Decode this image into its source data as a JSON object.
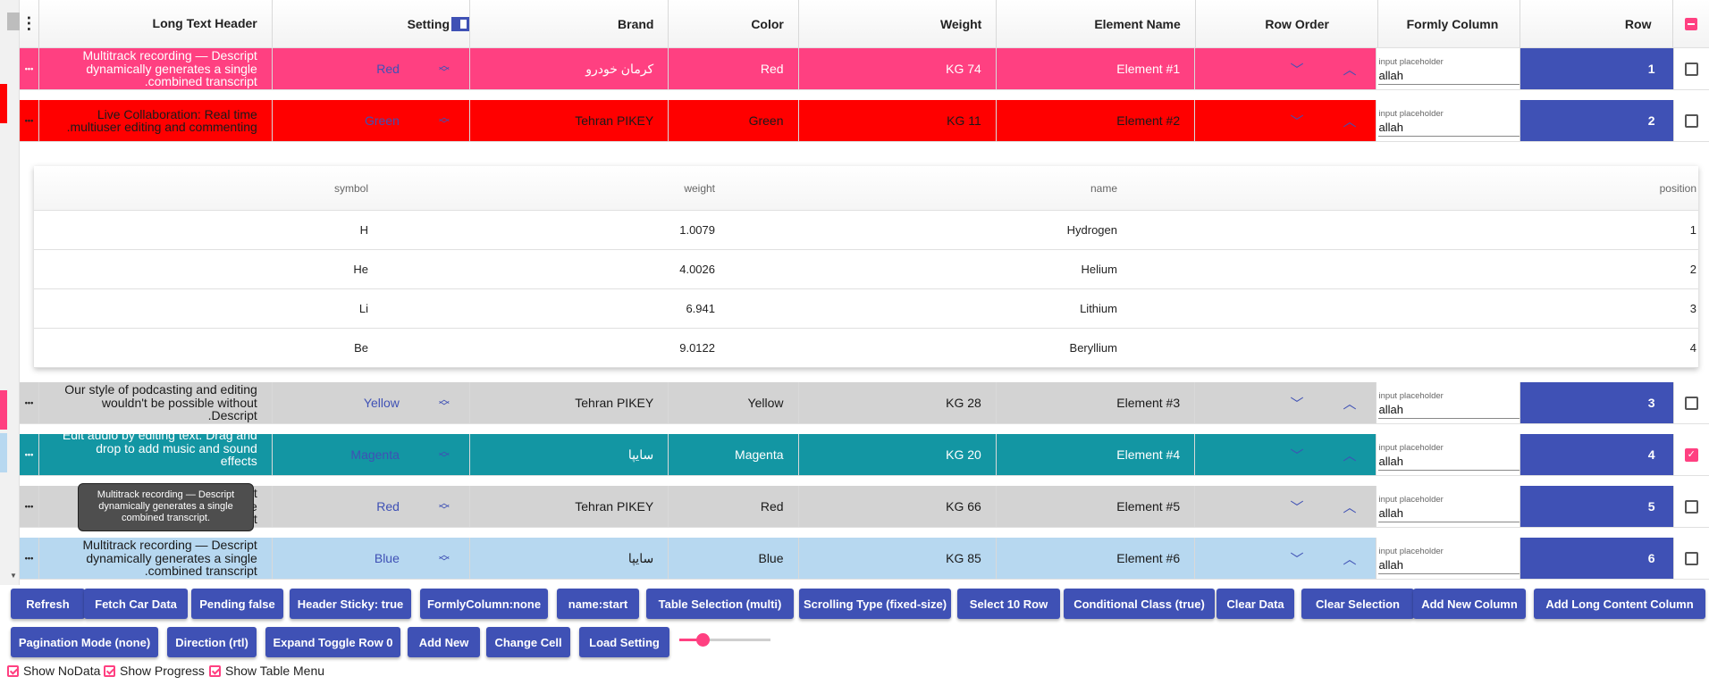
{
  "colors": {
    "accent": "#3f51b5",
    "pink": "#ff4081"
  },
  "header": {
    "long_text": "Long Text Header",
    "setting": "Setting",
    "brand": "Brand",
    "color": "Color",
    "weight": "Weight",
    "element_name": "Element Name",
    "row_order": "Row Order",
    "formly": "Formly Column",
    "row": "Row"
  },
  "rows": [
    {
      "long": [
        "Multitrack recording — Descript",
        "dynamically generates a single",
        ".combined transcript"
      ],
      "setting": "Red",
      "brand": "کرمان خودرو",
      "color": "Red",
      "weight": "KG 74",
      "name": "Element #1",
      "placeholder": "input placeholder",
      "value": "allah",
      "row": "1",
      "checked": false,
      "bg": "#ff4081",
      "text": "#ffffff"
    },
    {
      "long": [
        "Live Collaboration: Real time",
        ".multiuser editing and commenting"
      ],
      "setting": "Green",
      "brand": "Tehran PIKEY",
      "color": "Green",
      "weight": "KG 11",
      "name": "Element #2",
      "placeholder": "input placeholder",
      "value": "allah",
      "row": "2",
      "checked": false,
      "bg": "#ff0000",
      "text": "#1a1a1a"
    },
    {
      "long": [
        "Our style of podcasting and editing",
        "wouldn't be possible without",
        ".Descript"
      ],
      "setting": "Yellow",
      "brand": "Tehran PIKEY",
      "color": "Yellow",
      "weight": "KG 28",
      "name": "Element #3",
      "placeholder": "input placeholder",
      "value": "allah",
      "row": "3",
      "checked": false,
      "bg": "#d3d3d3",
      "text": "#1a1a1a"
    },
    {
      "long": [
        "Edit audio by editing text. Drag and",
        "drop to add music and sound",
        "effects",
        "."
      ],
      "setting": "Magenta",
      "brand": "سایپا",
      "color": "Magenta",
      "weight": "KG 20",
      "name": "Element #4",
      "placeholder": "input placeholder",
      "value": "allah",
      "row": "4",
      "checked": true,
      "bg": "#1396a3",
      "text": "#ffffff"
    },
    {
      "long": [
        "Multitrack recording — Descript",
        "dynamically generates a single",
        ".combined transcript"
      ],
      "setting": "Red",
      "brand": "Tehran PIKEY",
      "color": "Red",
      "weight": "KG 66",
      "name": "Element #5",
      "placeholder": "input placeholder",
      "value": "allah",
      "row": "5",
      "checked": false,
      "bg": "#d3d3d3",
      "text": "#1a1a1a"
    },
    {
      "long": [
        "Multitrack recording — Descript",
        "dynamically generates a single",
        ".combined transcript"
      ],
      "setting": "Blue",
      "brand": "سایپا",
      "color": "Blue",
      "weight": "KG 85",
      "name": "Element #6",
      "placeholder": "input placeholder",
      "value": "allah",
      "row": "6",
      "checked": false,
      "bg": "#b7d8f0",
      "text": "#1a1a1a"
    }
  ],
  "detail": {
    "headers": [
      "symbol",
      "weight",
      "name",
      "position"
    ],
    "rows": [
      [
        "H",
        "1.0079",
        "Hydrogen",
        "1"
      ],
      [
        "He",
        "4.0026",
        "Helium",
        "2"
      ],
      [
        "Li",
        "6.941",
        "Lithium",
        "3"
      ],
      [
        "Be",
        "9.0122",
        "Beryllium",
        "4"
      ]
    ]
  },
  "tooltip": "Multitrack recording — Descript dynamically generates a single combined transcript.",
  "buttons_row1": [
    "Refresh",
    "Fetch Car Data",
    "Pending false",
    "Header Sticky: true",
    "FormlyColumn:none",
    "name:start",
    "Table Selection (multi)",
    "Scrolling Type (fixed-size)",
    "Select 10 Row",
    "Conditional Class (true)",
    "Clear Data",
    "Clear Selection",
    "Add New Column",
    "Add Long Content Column"
  ],
  "buttons_row2": [
    "Pagination Mode (none)",
    "Direction (rtl)",
    "Expand Toggle Row 0",
    "Add New",
    "Change Cell",
    "Load Setting"
  ],
  "slider_value": 0.25,
  "checkboxes": [
    "Show NoData",
    "Show Progress",
    "Show Table Menu"
  ]
}
